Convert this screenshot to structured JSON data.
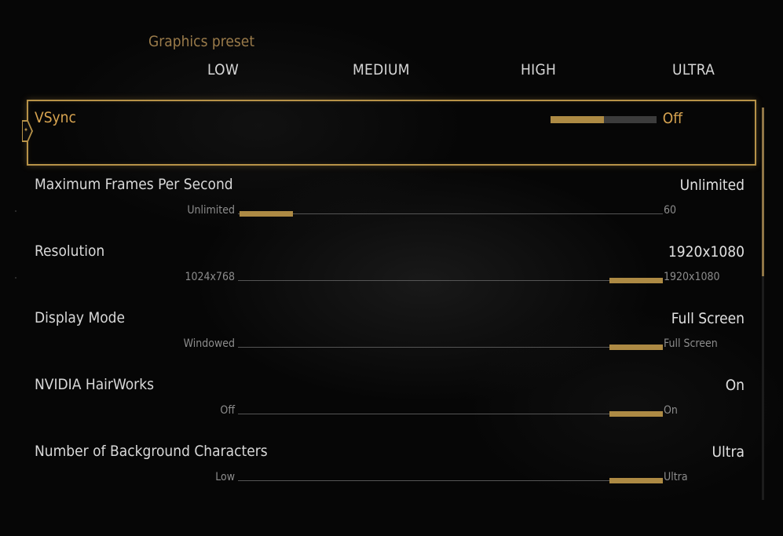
{
  "graphics_preset": {
    "label": "Graphics preset",
    "options": [
      "LOW",
      "MEDIUM",
      "HIGH",
      "ULTRA"
    ]
  },
  "settings": [
    {
      "name": "VSync",
      "value": "Off",
      "selected": true,
      "level": 0.5
    },
    {
      "name": "Maximum Frames Per Second",
      "value": "Unlimited",
      "min_label": "Unlimited",
      "max_label": "60",
      "level": 0.0
    },
    {
      "name": "Resolution",
      "value": "1920x1080",
      "min_label": "1024x768",
      "max_label": "1920x1080",
      "level": 1.0
    },
    {
      "name": "Display Mode",
      "value": "Full Screen",
      "min_label": "Windowed",
      "max_label": "Full Screen",
      "level": 1.0
    },
    {
      "name": "NVIDIA HairWorks",
      "value": "On",
      "min_label": "Off",
      "max_label": "On",
      "level": 1.0
    },
    {
      "name": "Number of Background Characters",
      "value": "Ultra",
      "min_label": "Low",
      "max_label": "Ultra",
      "level": 1.0
    }
  ],
  "scrollbar": {
    "position": 0.0,
    "visible_fraction": 0.43
  },
  "colors": {
    "accent": "#b79248",
    "thumb": "#ad8a44",
    "text": "#d8d8d8",
    "muted": "#8c8c8c"
  },
  "icons": {
    "selection_marker": "chevron-right-icon"
  }
}
